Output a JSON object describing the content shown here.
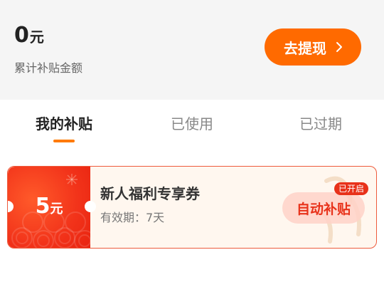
{
  "summary": {
    "amount": "0",
    "unit": "元",
    "caption": "累计补贴金额",
    "withdraw_label": "去提现"
  },
  "tabs": [
    {
      "label": "我的补贴",
      "active": true
    },
    {
      "label": "已使用",
      "active": false
    },
    {
      "label": "已过期",
      "active": false
    }
  ],
  "coupon": {
    "value": "5",
    "unit": "元",
    "title": "新人福利专享券",
    "validity": "有效期：7天",
    "action_label": "自动补贴",
    "status_badge": "已开启"
  },
  "colors": {
    "accent": "#ff6a00",
    "coupon_red": "#e8321a",
    "header_bg": "#f5f5f5"
  }
}
